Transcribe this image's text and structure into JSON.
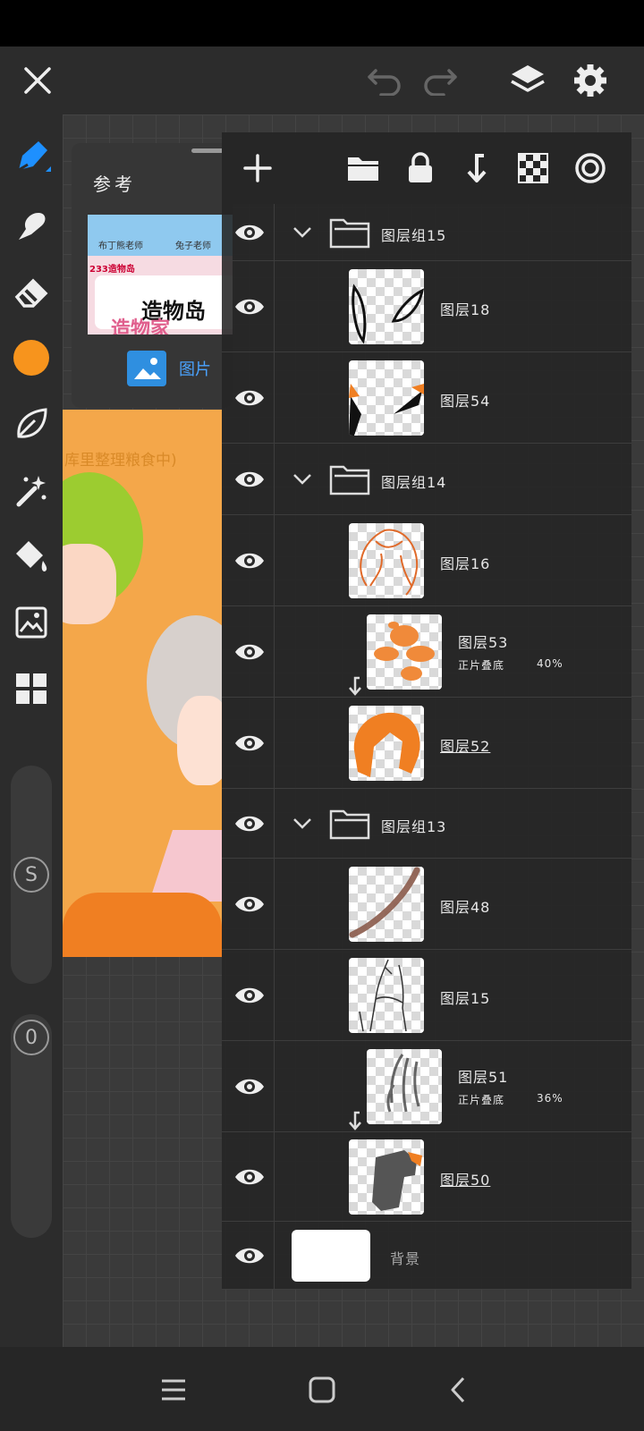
{
  "reference": {
    "title": "参考",
    "tab_label": "图片",
    "thumb_texts": [
      "布丁熊老师",
      "兔子老师",
      "233造物岛",
      "造物岛",
      "造物家"
    ]
  },
  "artwork": {
    "caption": "库里整理粮食中)"
  },
  "tools": {
    "active_color": "#f7941d",
    "size_slider_label": "S",
    "opacity_slider_label": "0"
  },
  "layers": [
    {
      "type": "group",
      "name": "图层组15"
    },
    {
      "type": "layer",
      "name": "图层18",
      "underline": false,
      "clipped": false
    },
    {
      "type": "layer",
      "name": "图层54",
      "underline": false,
      "clipped": false
    },
    {
      "type": "group",
      "name": "图层组14"
    },
    {
      "type": "layer",
      "name": "图层16",
      "underline": false,
      "clipped": false
    },
    {
      "type": "layer",
      "name": "图层53",
      "underline": false,
      "clipped": true,
      "blend": "正片叠底",
      "opacity": "40%"
    },
    {
      "type": "layer",
      "name": "图层52",
      "underline": true,
      "clipped": false
    },
    {
      "type": "group",
      "name": "图层组13"
    },
    {
      "type": "layer",
      "name": "图层48",
      "underline": false,
      "clipped": false
    },
    {
      "type": "layer",
      "name": "图层15",
      "underline": false,
      "clipped": false
    },
    {
      "type": "layer",
      "name": "图层51",
      "underline": false,
      "clipped": true,
      "blend": "正片叠底",
      "opacity": "36%"
    },
    {
      "type": "layer",
      "name": "图层50",
      "underline": true,
      "clipped": false
    },
    {
      "type": "background",
      "name": "背景"
    }
  ]
}
